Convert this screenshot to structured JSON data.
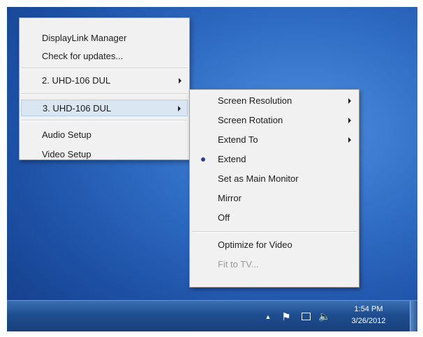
{
  "main_menu": {
    "items": [
      {
        "label": "DisplayLink Manager"
      },
      {
        "label": "Check for updates..."
      },
      {
        "label": "2. UHD-106 DUL"
      },
      {
        "label": "3. UHD-106 DUL"
      },
      {
        "label": "Audio Setup"
      },
      {
        "label": "Video Setup"
      }
    ]
  },
  "submenu": {
    "items": [
      {
        "label": "Screen Resolution"
      },
      {
        "label": "Screen Rotation"
      },
      {
        "label": "Extend To"
      },
      {
        "label": "Extend",
        "selected": true
      },
      {
        "label": "Set as Main Monitor"
      },
      {
        "label": "Mirror"
      },
      {
        "label": "Off"
      },
      {
        "label": "Optimize for Video"
      },
      {
        "label": "Fit to TV...",
        "disabled": true
      }
    ]
  },
  "taskbar": {
    "tray_icons": [
      "chevron-up-icon",
      "flag-icon",
      "network-icon",
      "volume-icon"
    ],
    "clock_time": "1:54 PM",
    "clock_date": "3/26/2012"
  },
  "colors": {
    "desktop": "#2f6cc4",
    "menu_bg": "#f1f1f1",
    "highlight": "#dbe6f3",
    "taskbar": "#1e4d8f"
  }
}
